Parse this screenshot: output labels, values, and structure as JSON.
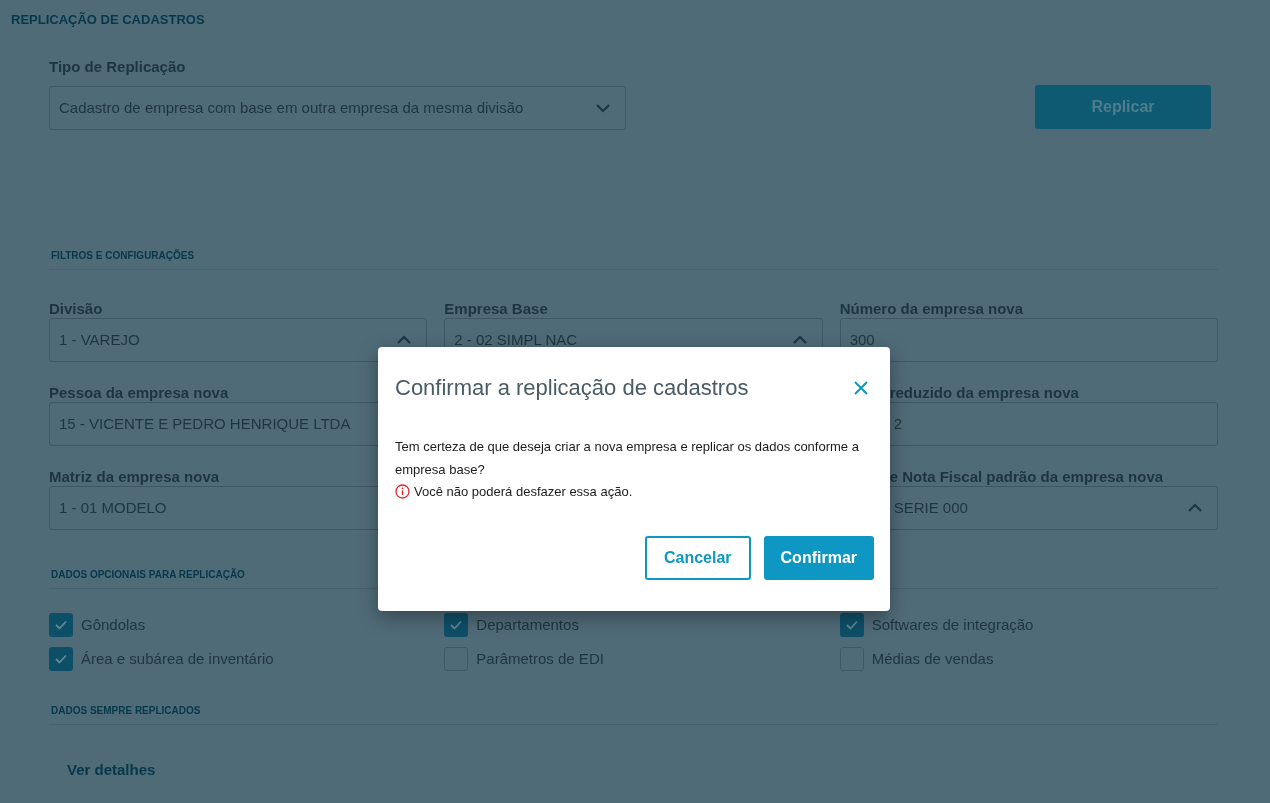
{
  "page_title": "REPLICAÇÃO DE CADASTROS",
  "replication_type": {
    "label": "Tipo de Replicação",
    "value": "Cadastro de empresa com base em outra empresa da mesma divisão"
  },
  "replicate_button": {
    "label": "Replicar",
    "disabled": true
  },
  "filters": {
    "title": "FILTROS E CONFIGURAÇÕES",
    "columns": [
      [
        {
          "label": "Divisão",
          "value": "1 - VAREJO",
          "kind": "select"
        },
        {
          "label": "Pessoa da empresa nova",
          "value": "15 - VICENTE E PEDRO HENRIQUE LTDA",
          "kind": "text"
        },
        {
          "label": "Matriz da empresa nova",
          "value": "1 - 01 MODELO",
          "kind": "text"
        }
      ],
      [
        {
          "label": "Empresa Base",
          "value": "2 - 02 SIMPL NAC",
          "kind": "select"
        }
      ],
      [
        {
          "label": "Número da empresa nova",
          "value": "300",
          "kind": "text"
        },
        {
          "label": "reduzido da empresa nova",
          "value": "2",
          "kind": "text",
          "partly_hidden": true
        },
        {
          "label": "e Nota Fiscal padrão da empresa nova",
          "value": "SERIE 000",
          "kind": "select",
          "partly_hidden": true
        }
      ]
    ]
  },
  "optional": {
    "title": "DADOS OPCIONAIS PARA REPLICAÇÃO",
    "items": [
      {
        "label": "Gôndolas",
        "checked": true
      },
      {
        "label": "Departamentos",
        "checked": true
      },
      {
        "label": "Softwares de integração",
        "checked": true
      },
      {
        "label": "Área e subárea de inventário",
        "checked": true
      },
      {
        "label": "Parâmetros de EDI",
        "checked": false
      },
      {
        "label": "Médias de vendas",
        "checked": false
      }
    ]
  },
  "always": {
    "title": "DADOS SEMPRE REPLICADOS",
    "link": "Ver detalhes"
  },
  "dialog": {
    "title": "Confirmar a replicação de cadastros",
    "message": "Tem certeza de que deseja criar a nova empresa e replicar os dados conforme a empresa base?",
    "warning": "Você não poderá desfazer essa ação.",
    "buttons": [
      {
        "label": "Cancelar",
        "kind": "secondary"
      },
      {
        "label": "Confirmar",
        "kind": "primary"
      }
    ]
  }
}
